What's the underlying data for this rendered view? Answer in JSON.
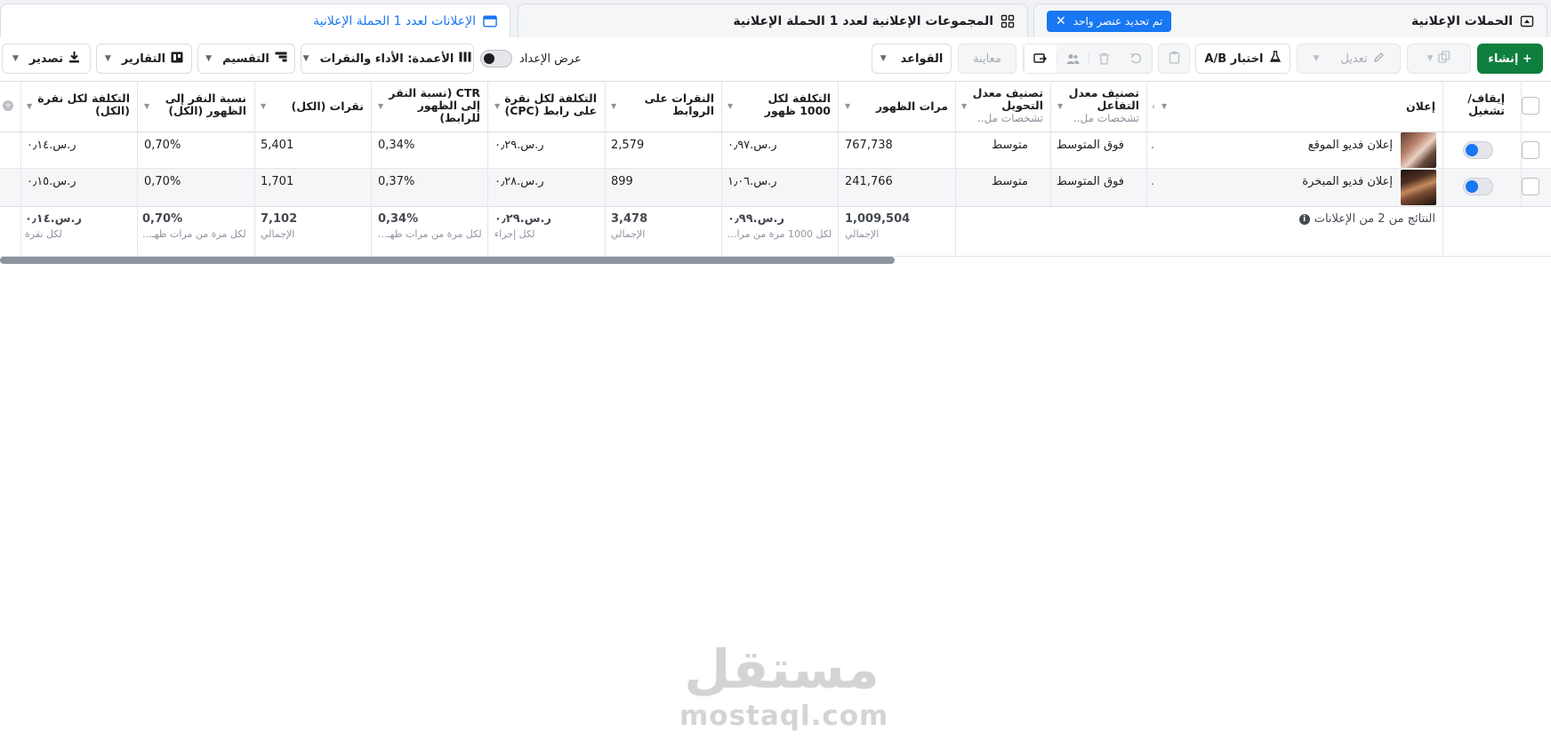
{
  "tabs": {
    "campaigns": {
      "label": "الحملات الإعلانية",
      "selection_pill": "تم تحديد عنصر واحد",
      "close": "✕"
    },
    "adsets": {
      "label": "المجموعات الإعلانية لعدد 1 الحملة الإعلانية"
    },
    "ads": {
      "label": "الإعلانات لعدد 1 الحملة الإعلانية"
    }
  },
  "toolbar": {
    "create_label": "+ إنشاء",
    "edit_label": "تعديل",
    "ab_test_label": "اختبار A/B",
    "preview_label": "معاينة",
    "rules_label": "القواعد",
    "setup_view_label": "عرض الإعداد",
    "columns_label": "الأعمدة: الأداء والنقرات",
    "breakdown_label": "التقسيم",
    "reports_label": "التقارير",
    "export_label": "تصدير"
  },
  "table": {
    "headers": {
      "onoff": "إيقاف/ تشغيل",
      "ad": "إعلان",
      "engagement_rank": "تصنيف معدل التفاعل",
      "engagement_rank_sub": "تشخصات مل..",
      "conversion_rank": "تصنيف معدل التحويل",
      "conversion_rank_sub": "تشخصات مل..",
      "impressions": "مرات الظهور",
      "cpm": "التكلفة لكل 1000 ظهور",
      "link_clicks": "النقرات على الروابط",
      "cpc": "التكلفة لكل نقرة على رابط (CPC)",
      "ctr": "CTR (نسبة النقر إلى الظهور للرابط)",
      "clicks_all": "نقرات (الكل)",
      "ctr_all": "نسبة النقر إلى الظهور (الكل)",
      "cpc_all": "التكلفة لكل نقرة (الكل)"
    },
    "rows": [
      {
        "ad": "إعلان فديو الموقع",
        "dot": ".",
        "engagement_rank": "فوق المتوسط",
        "conversion_rank": "متوسط",
        "impressions": "767,738",
        "cpm": "ر.س.٠٫٩٧",
        "link_clicks": "2,579",
        "cpc": "ر.س.٠٫٢٩",
        "ctr": "0,34%",
        "clicks_all": "5,401",
        "ctr_all": "0,70%",
        "cpc_all": "ر.س.٠٫١٤"
      },
      {
        "ad": "إعلان فديو المبخرة",
        "dot": ".",
        "engagement_rank": "فوق المتوسط",
        "conversion_rank": "متوسط",
        "impressions": "241,766",
        "cpm": "ر.س.١٫٠٦",
        "link_clicks": "899",
        "cpc": "ر.س.٠٫٢٨",
        "ctr": "0,37%",
        "clicks_all": "1,701",
        "ctr_all": "0,70%",
        "cpc_all": "ر.س.٠٫١٥"
      }
    ],
    "summary": {
      "label": "النتائج من 2 من الإعلانات",
      "impressions": "1,009,504",
      "impressions_lbl": "الإجمالي",
      "cpm": "ر.س.٠٫٩٩",
      "cpm_lbl": "لكل 1000 مرة من مرا...",
      "link_clicks": "3,478",
      "link_clicks_lbl": "الإجمالي",
      "cpc": "ر.س.٠٫٢٩",
      "cpc_lbl": "لكل إجراء",
      "ctr": "0,34%",
      "ctr_lbl": "لكل مرة من مرات ظهـ...",
      "clicks_all": "7,102",
      "clicks_all_lbl": "الإجمالي",
      "ctr_all": "0,70%",
      "ctr_all_lbl": "لكل مرة من مرات ظهـ...",
      "cpc_all": "ر.س.٠٫١٤",
      "cpc_all_lbl": "لكل نقرة"
    }
  },
  "watermark": {
    "arabic": "مستقل",
    "latin": "mostaql.com"
  },
  "colors": {
    "accent": "#1877f2",
    "create_button": "#0f7f3e",
    "border": "#dadde1"
  },
  "icons": [
    "campaign-folder-icon",
    "adsets-grid-icon",
    "ads-window-icon",
    "plus-icon",
    "copy-icon",
    "pencil-icon",
    "flask-icon",
    "trash-icon",
    "undo-icon",
    "audience-icon",
    "share-icon",
    "columns-icon",
    "breakdown-icon",
    "reports-icon",
    "download-icon",
    "info-icon"
  ]
}
